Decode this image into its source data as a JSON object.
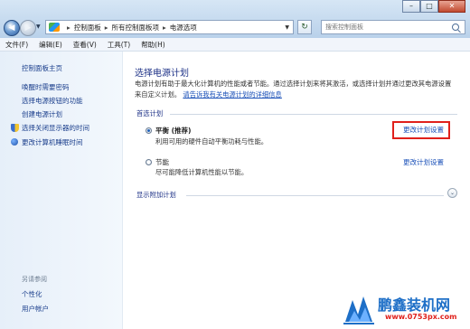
{
  "address_bar": {
    "breadcrumbs": [
      "控制面板",
      "所有控制面板项",
      "电源选项"
    ],
    "search_placeholder": "搜索控制面板"
  },
  "window_controls": {
    "minimize": "–",
    "maximize": "□",
    "close": "✕"
  },
  "menu": [
    "文件(F)",
    "编辑(E)",
    "查看(V)",
    "工具(T)",
    "帮助(H)"
  ],
  "sidebar": {
    "items": [
      {
        "label": "控制面板主页"
      },
      {
        "label": "唤醒时需要密码"
      },
      {
        "label": "选择电源按钮的功能"
      },
      {
        "label": "创建电源计划"
      },
      {
        "label": "选择关闭显示器的时间"
      },
      {
        "label": "更改计算机睡眠时间"
      }
    ],
    "see_also": {
      "heading": "另请参阅",
      "items": [
        {
          "label": "个性化"
        },
        {
          "label": "用户帐户"
        }
      ]
    }
  },
  "main": {
    "title": "选择电源计划",
    "description": "电源计划有助于最大化计算机的性能或者节能。通过选择计划来将其激活，或选择计划并通过更改其电源设置来自定义计划。",
    "description_link": "请告诉我有关电源计划的详细信息",
    "preferred_section": "首选计划",
    "plans": [
      {
        "name": "平衡 (推荐)",
        "description": "利用可用的硬件自动平衡功耗与性能。",
        "link": "更改计划设置",
        "selected": true
      },
      {
        "name": "节能",
        "description": "尽可能降低计算机性能以节能。",
        "link": "更改计划设置",
        "selected": false
      }
    ],
    "more_plans": "显示附加计划"
  },
  "watermark": {
    "title": "鹏鑫装机网",
    "url": "www.0753px.com"
  },
  "colors": {
    "link": "#1a50b8",
    "heading": "#1e3287",
    "highlight": "#e0201b",
    "sidebar_bg": "#e6eff9"
  }
}
